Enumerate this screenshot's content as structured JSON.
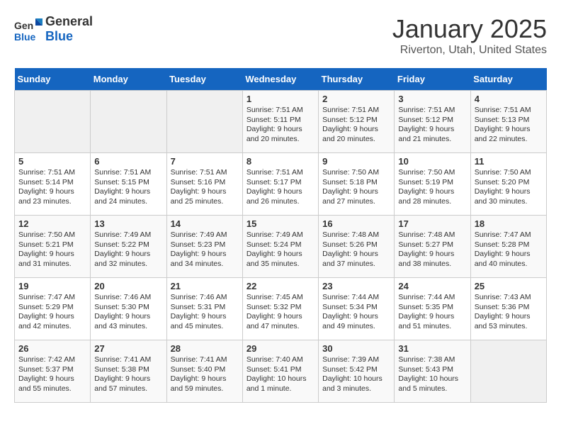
{
  "header": {
    "logo_line1": "General",
    "logo_line2": "Blue",
    "title": "January 2025",
    "subtitle": "Riverton, Utah, United States"
  },
  "days_of_week": [
    "Sunday",
    "Monday",
    "Tuesday",
    "Wednesday",
    "Thursday",
    "Friday",
    "Saturday"
  ],
  "weeks": [
    [
      {
        "day": "",
        "content": ""
      },
      {
        "day": "",
        "content": ""
      },
      {
        "day": "",
        "content": ""
      },
      {
        "day": "1",
        "content": "Sunrise: 7:51 AM\nSunset: 5:11 PM\nDaylight: 9 hours\nand 20 minutes."
      },
      {
        "day": "2",
        "content": "Sunrise: 7:51 AM\nSunset: 5:12 PM\nDaylight: 9 hours\nand 20 minutes."
      },
      {
        "day": "3",
        "content": "Sunrise: 7:51 AM\nSunset: 5:12 PM\nDaylight: 9 hours\nand 21 minutes."
      },
      {
        "day": "4",
        "content": "Sunrise: 7:51 AM\nSunset: 5:13 PM\nDaylight: 9 hours\nand 22 minutes."
      }
    ],
    [
      {
        "day": "5",
        "content": "Sunrise: 7:51 AM\nSunset: 5:14 PM\nDaylight: 9 hours\nand 23 minutes."
      },
      {
        "day": "6",
        "content": "Sunrise: 7:51 AM\nSunset: 5:15 PM\nDaylight: 9 hours\nand 24 minutes."
      },
      {
        "day": "7",
        "content": "Sunrise: 7:51 AM\nSunset: 5:16 PM\nDaylight: 9 hours\nand 25 minutes."
      },
      {
        "day": "8",
        "content": "Sunrise: 7:51 AM\nSunset: 5:17 PM\nDaylight: 9 hours\nand 26 minutes."
      },
      {
        "day": "9",
        "content": "Sunrise: 7:50 AM\nSunset: 5:18 PM\nDaylight: 9 hours\nand 27 minutes."
      },
      {
        "day": "10",
        "content": "Sunrise: 7:50 AM\nSunset: 5:19 PM\nDaylight: 9 hours\nand 28 minutes."
      },
      {
        "day": "11",
        "content": "Sunrise: 7:50 AM\nSunset: 5:20 PM\nDaylight: 9 hours\nand 30 minutes."
      }
    ],
    [
      {
        "day": "12",
        "content": "Sunrise: 7:50 AM\nSunset: 5:21 PM\nDaylight: 9 hours\nand 31 minutes."
      },
      {
        "day": "13",
        "content": "Sunrise: 7:49 AM\nSunset: 5:22 PM\nDaylight: 9 hours\nand 32 minutes."
      },
      {
        "day": "14",
        "content": "Sunrise: 7:49 AM\nSunset: 5:23 PM\nDaylight: 9 hours\nand 34 minutes."
      },
      {
        "day": "15",
        "content": "Sunrise: 7:49 AM\nSunset: 5:24 PM\nDaylight: 9 hours\nand 35 minutes."
      },
      {
        "day": "16",
        "content": "Sunrise: 7:48 AM\nSunset: 5:26 PM\nDaylight: 9 hours\nand 37 minutes."
      },
      {
        "day": "17",
        "content": "Sunrise: 7:48 AM\nSunset: 5:27 PM\nDaylight: 9 hours\nand 38 minutes."
      },
      {
        "day": "18",
        "content": "Sunrise: 7:47 AM\nSunset: 5:28 PM\nDaylight: 9 hours\nand 40 minutes."
      }
    ],
    [
      {
        "day": "19",
        "content": "Sunrise: 7:47 AM\nSunset: 5:29 PM\nDaylight: 9 hours\nand 42 minutes."
      },
      {
        "day": "20",
        "content": "Sunrise: 7:46 AM\nSunset: 5:30 PM\nDaylight: 9 hours\nand 43 minutes."
      },
      {
        "day": "21",
        "content": "Sunrise: 7:46 AM\nSunset: 5:31 PM\nDaylight: 9 hours\nand 45 minutes."
      },
      {
        "day": "22",
        "content": "Sunrise: 7:45 AM\nSunset: 5:32 PM\nDaylight: 9 hours\nand 47 minutes."
      },
      {
        "day": "23",
        "content": "Sunrise: 7:44 AM\nSunset: 5:34 PM\nDaylight: 9 hours\nand 49 minutes."
      },
      {
        "day": "24",
        "content": "Sunrise: 7:44 AM\nSunset: 5:35 PM\nDaylight: 9 hours\nand 51 minutes."
      },
      {
        "day": "25",
        "content": "Sunrise: 7:43 AM\nSunset: 5:36 PM\nDaylight: 9 hours\nand 53 minutes."
      }
    ],
    [
      {
        "day": "26",
        "content": "Sunrise: 7:42 AM\nSunset: 5:37 PM\nDaylight: 9 hours\nand 55 minutes."
      },
      {
        "day": "27",
        "content": "Sunrise: 7:41 AM\nSunset: 5:38 PM\nDaylight: 9 hours\nand 57 minutes."
      },
      {
        "day": "28",
        "content": "Sunrise: 7:41 AM\nSunset: 5:40 PM\nDaylight: 9 hours\nand 59 minutes."
      },
      {
        "day": "29",
        "content": "Sunrise: 7:40 AM\nSunset: 5:41 PM\nDaylight: 10 hours\nand 1 minute."
      },
      {
        "day": "30",
        "content": "Sunrise: 7:39 AM\nSunset: 5:42 PM\nDaylight: 10 hours\nand 3 minutes."
      },
      {
        "day": "31",
        "content": "Sunrise: 7:38 AM\nSunset: 5:43 PM\nDaylight: 10 hours\nand 5 minutes."
      },
      {
        "day": "",
        "content": ""
      }
    ]
  ]
}
